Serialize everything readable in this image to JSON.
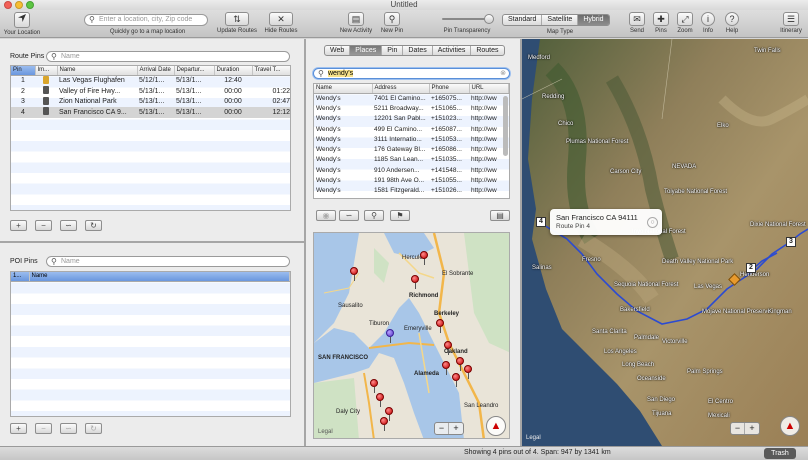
{
  "window": {
    "title": "Untitled"
  },
  "toolbar": {
    "your_location": "Your Location",
    "search_placeholder": "Enter a location, city, Zip code",
    "search_hint": "Quickly go to a map location",
    "update_routes": "Update Routes",
    "hide_routes": "Hide Routes",
    "new_activity": "New Activity",
    "new_pin": "New Pin",
    "pin_transparency": "Pin Transparency",
    "map_types": [
      "Standard",
      "Satellite",
      "Hybrid"
    ],
    "map_type_selected": "Hybrid",
    "map_type_label": "Map Type",
    "send": "Send",
    "pins": "Pins",
    "zoom": "Zoom",
    "info": "Info",
    "help": "Help",
    "itinerary": "Itinerary"
  },
  "route_pins": {
    "title": "Route Pins",
    "search_placeholder": "Name",
    "columns": [
      "Pin",
      "Im...",
      "Name",
      "Arrival Date",
      "Departur...",
      "Duration",
      "Travel T..."
    ],
    "rows": [
      {
        "pin": "1",
        "name": "Las Vegas Flughafen",
        "arrival": "5/12/1...",
        "departure": "5/13/1...",
        "duration": "12:40",
        "travel": ""
      },
      {
        "pin": "2",
        "name": "Valley of Fire Hwy...",
        "arrival": "5/13/1...",
        "departure": "5/13/1...",
        "duration": "00:00",
        "travel": "01:22"
      },
      {
        "pin": "3",
        "name": "Zion National Park",
        "arrival": "5/13/1...",
        "departure": "5/13/1...",
        "duration": "00:00",
        "travel": "02:47"
      },
      {
        "pin": "4",
        "name": "San Francisco CA 9...",
        "arrival": "5/13/1...",
        "departure": "5/13/1...",
        "duration": "00:00",
        "travel": "12:12"
      }
    ]
  },
  "poi_pins": {
    "title": "POI Pins",
    "search_placeholder": "Name",
    "columns": [
      "1...",
      "Name"
    ]
  },
  "places": {
    "tabs": [
      "Web",
      "Places",
      "Pin",
      "Dates",
      "Activities",
      "Routes"
    ],
    "active_tab": "Places",
    "search_value": "wendy's",
    "columns": [
      "Name",
      "Address",
      "Phone",
      "URL"
    ],
    "rows": [
      {
        "name": "Wendy's",
        "address": "7401 El Camino...",
        "phone": "+165075...",
        "url": "http://ww"
      },
      {
        "name": "Wendy's",
        "address": "5211 Broadway...",
        "phone": "+151065...",
        "url": "http://ww"
      },
      {
        "name": "Wendy's",
        "address": "12201 San Pabl...",
        "phone": "+151023...",
        "url": "http://ww"
      },
      {
        "name": "Wendy's",
        "address": "499 El Camino...",
        "phone": "+165087...",
        "url": "http://ww"
      },
      {
        "name": "Wendy's",
        "address": "3111 Internatio...",
        "phone": "+151053...",
        "url": "http://ww"
      },
      {
        "name": "Wendy's",
        "address": "176 Gateway Bl...",
        "phone": "+165086...",
        "url": "http://ww"
      },
      {
        "name": "Wendy's",
        "address": "1185 San Lean...",
        "phone": "+151035...",
        "url": "http://ww"
      },
      {
        "name": "Wendy's",
        "address": "910 Andersen...",
        "phone": "+141548...",
        "url": "http://ww"
      },
      {
        "name": "Wendy's",
        "address": "191 98th Ave O...",
        "phone": "+151055...",
        "url": "http://ww"
      },
      {
        "name": "Wendy's",
        "address": "1581 Fitzgerald...",
        "phone": "+151026...",
        "url": "http://ww"
      }
    ],
    "map_labels": [
      "Richmond",
      "El Sobrante",
      "Hercules",
      "Berkeley",
      "Emeryville",
      "Oakland",
      "Alameda",
      "SAN FRANCISCO",
      "Daly City",
      "San Leandro",
      "Sausalito",
      "Tiburon",
      "Legal"
    ]
  },
  "main_map": {
    "labels": [
      "Medford",
      "Elko",
      "NEVADA",
      "Carson City",
      "Salinas",
      "Fresno",
      "Bakersfield",
      "Las Vegas",
      "Henderson",
      "Santa Clarita",
      "Los Angeles",
      "Long Beach",
      "Oceanside",
      "San Diego",
      "Twin Falls",
      "Mojave National Preserve",
      "Death Valley National Park",
      "Sequoia National Forest",
      "Inyo National Forest",
      "Plumas National Forest",
      "Toiyabe National Forest",
      "Dixie National Forest",
      "Redding",
      "Chico",
      "Palmdale",
      "Victorville",
      "Palm Springs",
      "El Centro",
      "Tijuana",
      "Mexicali",
      "Kingman"
    ],
    "callout_title": "San Francisco CA 94111",
    "callout_sub": "Route Pin 4",
    "route_markers": [
      "4",
      "2",
      "3"
    ],
    "legal": "Legal"
  },
  "status": {
    "text": "Showing 4 pins out of 4. Span: 947 by 1341 km",
    "trash": "Trash"
  }
}
